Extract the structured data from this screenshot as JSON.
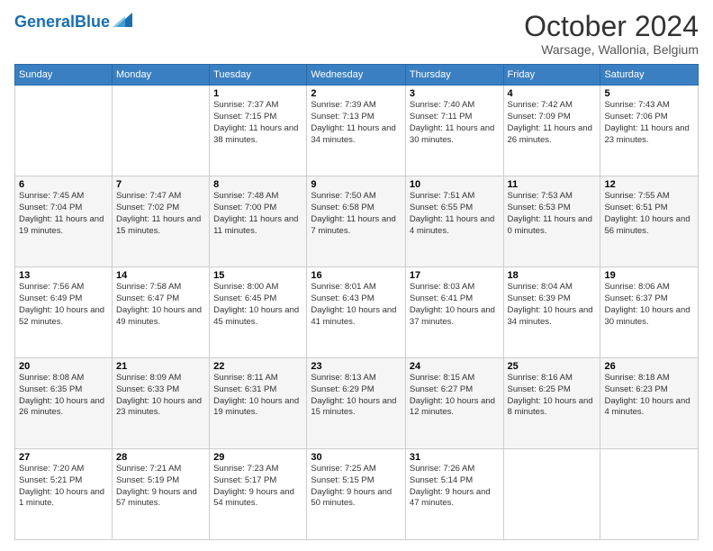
{
  "header": {
    "logo_general": "General",
    "logo_blue": "Blue",
    "month_title": "October 2024",
    "location": "Warsage, Wallonia, Belgium"
  },
  "days_of_week": [
    "Sunday",
    "Monday",
    "Tuesday",
    "Wednesday",
    "Thursday",
    "Friday",
    "Saturday"
  ],
  "weeks": [
    [
      {
        "day": "",
        "info": ""
      },
      {
        "day": "",
        "info": ""
      },
      {
        "day": "1",
        "info": "Sunrise: 7:37 AM\nSunset: 7:15 PM\nDaylight: 11 hours and 38 minutes."
      },
      {
        "day": "2",
        "info": "Sunrise: 7:39 AM\nSunset: 7:13 PM\nDaylight: 11 hours and 34 minutes."
      },
      {
        "day": "3",
        "info": "Sunrise: 7:40 AM\nSunset: 7:11 PM\nDaylight: 11 hours and 30 minutes."
      },
      {
        "day": "4",
        "info": "Sunrise: 7:42 AM\nSunset: 7:09 PM\nDaylight: 11 hours and 26 minutes."
      },
      {
        "day": "5",
        "info": "Sunrise: 7:43 AM\nSunset: 7:06 PM\nDaylight: 11 hours and 23 minutes."
      }
    ],
    [
      {
        "day": "6",
        "info": "Sunrise: 7:45 AM\nSunset: 7:04 PM\nDaylight: 11 hours and 19 minutes."
      },
      {
        "day": "7",
        "info": "Sunrise: 7:47 AM\nSunset: 7:02 PM\nDaylight: 11 hours and 15 minutes."
      },
      {
        "day": "8",
        "info": "Sunrise: 7:48 AM\nSunset: 7:00 PM\nDaylight: 11 hours and 11 minutes."
      },
      {
        "day": "9",
        "info": "Sunrise: 7:50 AM\nSunset: 6:58 PM\nDaylight: 11 hours and 7 minutes."
      },
      {
        "day": "10",
        "info": "Sunrise: 7:51 AM\nSunset: 6:55 PM\nDaylight: 11 hours and 4 minutes."
      },
      {
        "day": "11",
        "info": "Sunrise: 7:53 AM\nSunset: 6:53 PM\nDaylight: 11 hours and 0 minutes."
      },
      {
        "day": "12",
        "info": "Sunrise: 7:55 AM\nSunset: 6:51 PM\nDaylight: 10 hours and 56 minutes."
      }
    ],
    [
      {
        "day": "13",
        "info": "Sunrise: 7:56 AM\nSunset: 6:49 PM\nDaylight: 10 hours and 52 minutes."
      },
      {
        "day": "14",
        "info": "Sunrise: 7:58 AM\nSunset: 6:47 PM\nDaylight: 10 hours and 49 minutes."
      },
      {
        "day": "15",
        "info": "Sunrise: 8:00 AM\nSunset: 6:45 PM\nDaylight: 10 hours and 45 minutes."
      },
      {
        "day": "16",
        "info": "Sunrise: 8:01 AM\nSunset: 6:43 PM\nDaylight: 10 hours and 41 minutes."
      },
      {
        "day": "17",
        "info": "Sunrise: 8:03 AM\nSunset: 6:41 PM\nDaylight: 10 hours and 37 minutes."
      },
      {
        "day": "18",
        "info": "Sunrise: 8:04 AM\nSunset: 6:39 PM\nDaylight: 10 hours and 34 minutes."
      },
      {
        "day": "19",
        "info": "Sunrise: 8:06 AM\nSunset: 6:37 PM\nDaylight: 10 hours and 30 minutes."
      }
    ],
    [
      {
        "day": "20",
        "info": "Sunrise: 8:08 AM\nSunset: 6:35 PM\nDaylight: 10 hours and 26 minutes."
      },
      {
        "day": "21",
        "info": "Sunrise: 8:09 AM\nSunset: 6:33 PM\nDaylight: 10 hours and 23 minutes."
      },
      {
        "day": "22",
        "info": "Sunrise: 8:11 AM\nSunset: 6:31 PM\nDaylight: 10 hours and 19 minutes."
      },
      {
        "day": "23",
        "info": "Sunrise: 8:13 AM\nSunset: 6:29 PM\nDaylight: 10 hours and 15 minutes."
      },
      {
        "day": "24",
        "info": "Sunrise: 8:15 AM\nSunset: 6:27 PM\nDaylight: 10 hours and 12 minutes."
      },
      {
        "day": "25",
        "info": "Sunrise: 8:16 AM\nSunset: 6:25 PM\nDaylight: 10 hours and 8 minutes."
      },
      {
        "day": "26",
        "info": "Sunrise: 8:18 AM\nSunset: 6:23 PM\nDaylight: 10 hours and 4 minutes."
      }
    ],
    [
      {
        "day": "27",
        "info": "Sunrise: 7:20 AM\nSunset: 5:21 PM\nDaylight: 10 hours and 1 minute."
      },
      {
        "day": "28",
        "info": "Sunrise: 7:21 AM\nSunset: 5:19 PM\nDaylight: 9 hours and 57 minutes."
      },
      {
        "day": "29",
        "info": "Sunrise: 7:23 AM\nSunset: 5:17 PM\nDaylight: 9 hours and 54 minutes."
      },
      {
        "day": "30",
        "info": "Sunrise: 7:25 AM\nSunset: 5:15 PM\nDaylight: 9 hours and 50 minutes."
      },
      {
        "day": "31",
        "info": "Sunrise: 7:26 AM\nSunset: 5:14 PM\nDaylight: 9 hours and 47 minutes."
      },
      {
        "day": "",
        "info": ""
      },
      {
        "day": "",
        "info": ""
      }
    ]
  ]
}
